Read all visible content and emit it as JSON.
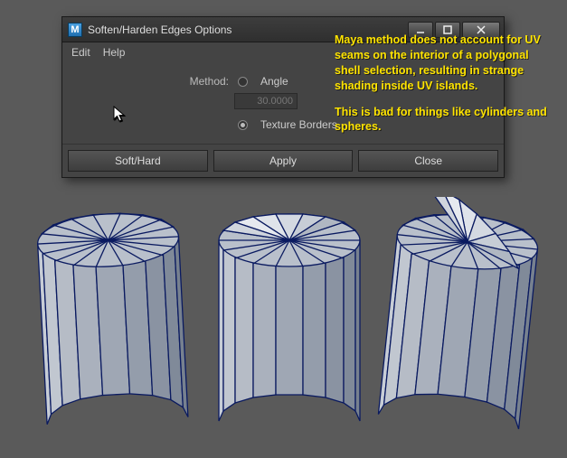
{
  "window": {
    "title": "Soften/Harden Edges Options",
    "app_badge": "M"
  },
  "menubar": {
    "edit": "Edit",
    "help": "Help"
  },
  "options": {
    "method_label": "Method:",
    "angle_label": "Angle",
    "angle_value": "30.0000",
    "texture_borders_label": "Texture Borders"
  },
  "buttons": {
    "softhard": "Soft/Hard",
    "apply": "Apply",
    "close": "Close"
  },
  "annotation": {
    "p1": "Maya method does not account for UV seams on the interior of a polygonal shell selection, resulting in strange shading inside UV islands.",
    "p2": "This is bad for things like cylinders and spheres."
  }
}
